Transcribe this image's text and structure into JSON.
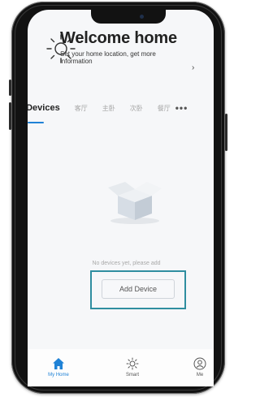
{
  "header": {
    "title": "Welcome home",
    "subtitle": "Set your home location, get more information",
    "chevron": "›"
  },
  "tabs": [
    {
      "label": "All Devices",
      "active": true
    },
    {
      "label": "客厅"
    },
    {
      "label": "主卧"
    },
    {
      "label": "次卧"
    },
    {
      "label": "餐厅"
    },
    {
      "label": "•••"
    }
  ],
  "empty_state": {
    "message": "No devices yet, please add",
    "button_label": "Add Device"
  },
  "bottom_nav": [
    {
      "label": "My Home",
      "icon": "home-icon",
      "active": true
    },
    {
      "label": "Smart",
      "icon": "sun-icon"
    },
    {
      "label": "Me",
      "icon": "user-icon"
    }
  ],
  "colors": {
    "accent": "#1f82d6",
    "highlight_border": "#2f8ea0"
  }
}
